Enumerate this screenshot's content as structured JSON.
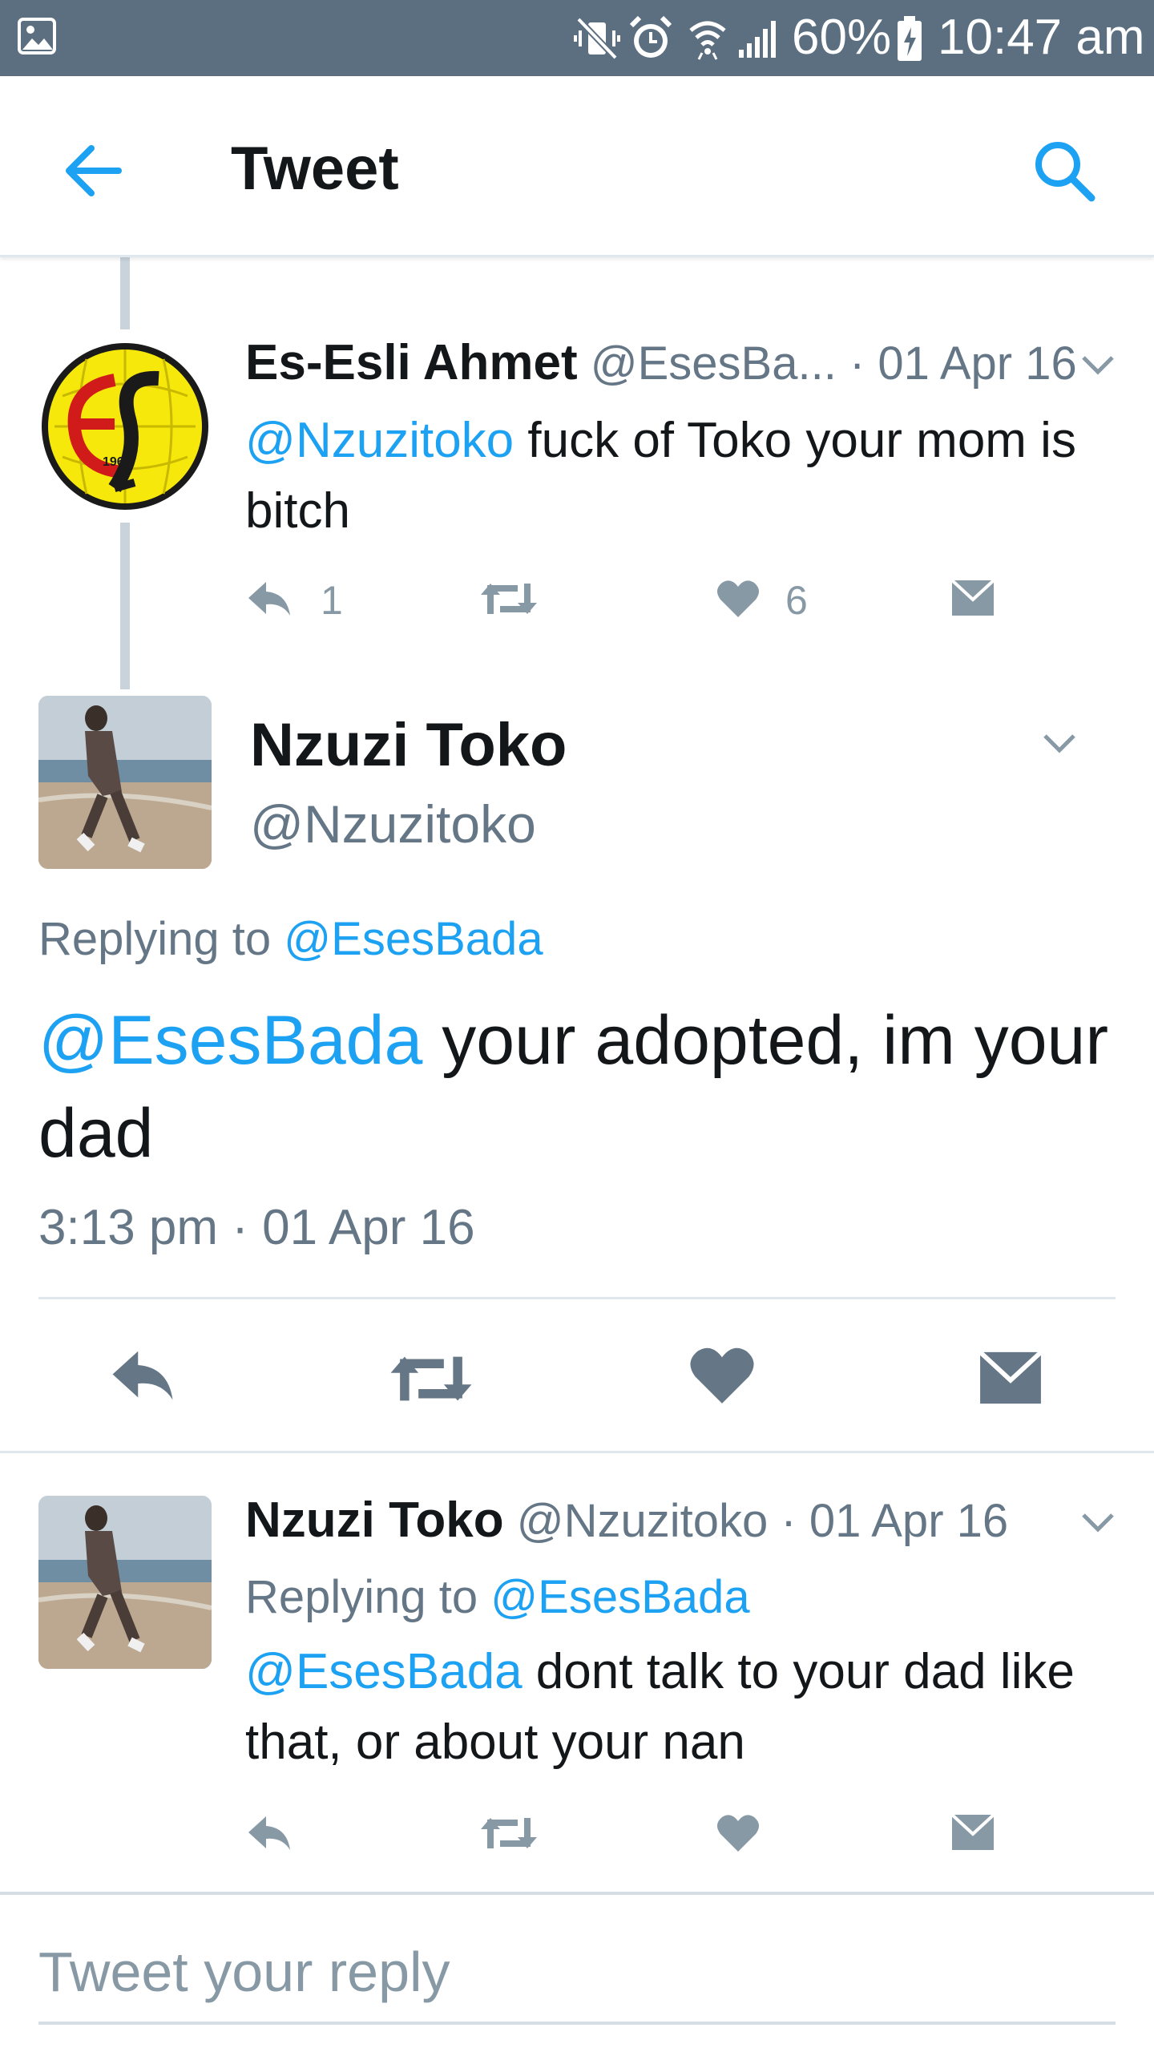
{
  "status_bar": {
    "battery": "60%",
    "time": "10:47 am",
    "colors": {
      "background": "#5c6f81"
    }
  },
  "app_bar": {
    "title": "Tweet",
    "back_icon": "arrow-left-icon",
    "search_icon": "search-icon"
  },
  "parent_tweet": {
    "name": "Es-Esli Ahmet",
    "handle": "@EsesBa...",
    "date": "· 01 Apr 16",
    "mention": "@Nzuzitoko",
    "text": " fuck of Toko your mom is bitch",
    "avatar_text": "1965",
    "reply_count": "1",
    "like_count": "6"
  },
  "main_tweet": {
    "name": "Nzuzi Toko",
    "handle": "@Nzuzitoko",
    "replying_prefix": "Replying to ",
    "replying_handle": "@EsesBada",
    "mention": "@EsesBada",
    "text": " your adopted, im your dad",
    "timestamp": "3:13 pm · 01 Apr 16"
  },
  "reply_tweet": {
    "name": "Nzuzi Toko",
    "handle": "@Nzuzitoko",
    "date": "· 01 Apr 16",
    "replying_prefix": "Replying to ",
    "replying_handle": "@EsesBada",
    "mention": "@EsesBada",
    "text": " dont talk to your dad like that, or about your nan"
  },
  "reply_box": {
    "placeholder": "Tweet your reply"
  },
  "colors": {
    "link": "#1da1f2",
    "muted": "#657786",
    "icon": "#8899a6",
    "icon_dark": "#657786"
  }
}
